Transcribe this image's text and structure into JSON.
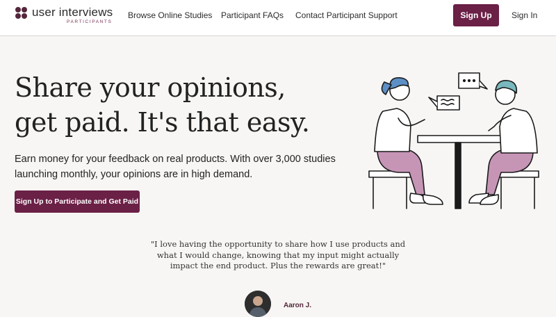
{
  "brand": {
    "name": "user interviews",
    "sub": "PARTICIPANTS",
    "accent": "#6b2046"
  },
  "nav": {
    "links": [
      "Browse Online Studies",
      "Participant FAQs",
      "Contact Participant Support"
    ],
    "signup_label": "Sign Up",
    "signin_label": "Sign In"
  },
  "hero": {
    "title_line1": "Share your opinions,",
    "title_line2": "get paid. It's that easy.",
    "body": "Earn money for your feedback on real products. With over 3,000 studies launching monthly, your opinions are in high demand.",
    "cta_label": "Sign Up to Participate and Get Paid"
  },
  "testimonial": {
    "quote": "\"I love having the opportunity to share how I use products and what I would change, knowing that my input might actually impact the end product. Plus the rewards are great!\"",
    "author": "Aaron J."
  },
  "icons": [
    "logo-mark-icon",
    "speech-bubble-dots-icon",
    "speech-bubble-lines-icon"
  ]
}
